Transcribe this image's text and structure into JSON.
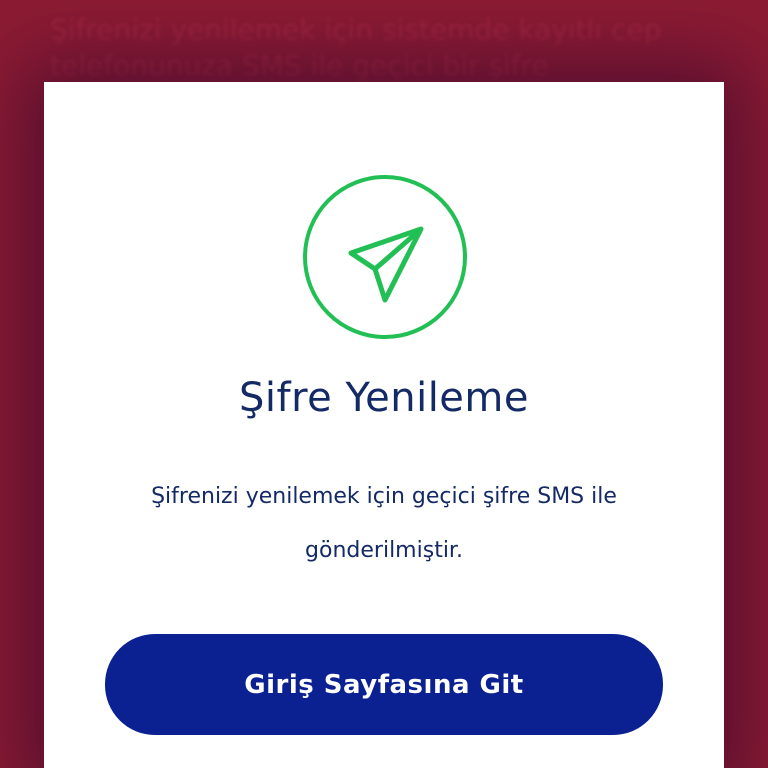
{
  "background": {
    "text": "Şifrenizi yenilemek için sistemde kayıtlı cep telefonunuza SMS ile geçici bir şifre"
  },
  "modal": {
    "icon": "send-paper-plane-icon",
    "title": "Şifre Yenileme",
    "message": "Şifrenizi yenilemek için geçici şifre SMS ile gönderilmiştir.",
    "button_label": "Giriş Sayfasına Git"
  },
  "colors": {
    "background": "#8c1b33",
    "icon_green": "#22bf55",
    "title_text": "#142a66",
    "button": "#0b2192"
  }
}
